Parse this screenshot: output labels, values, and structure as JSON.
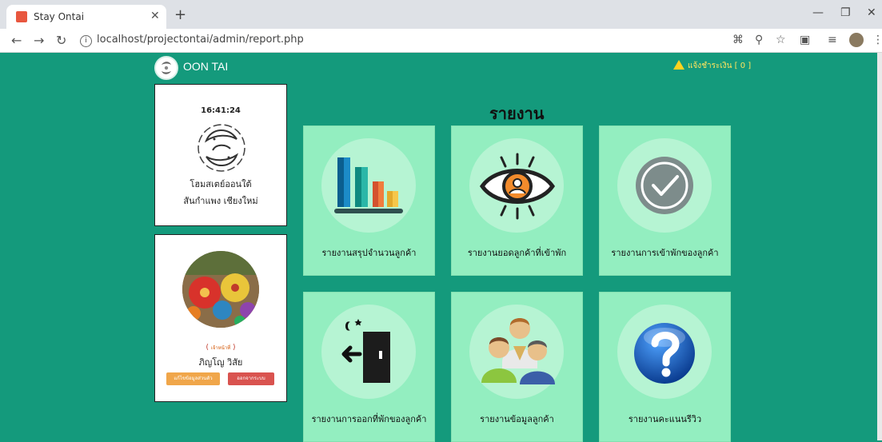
{
  "browser": {
    "tab_title": "Stay Ontai",
    "tab_favicon": "ON",
    "new_tab": "+",
    "url": "localhost/projectontai/admin/report.php",
    "info_glyph": "i"
  },
  "header": {
    "brand": "OON TAI",
    "alert_text": "แจ้งชำระเงิน [ 0 ]"
  },
  "sidebar": {
    "clock": "16:41:24",
    "hotel_name": "โฮมสเตย์ออนใต้",
    "hotel_address": "สันกำแพง เชียงใหม่",
    "role_open": "(",
    "role": "เจ้าหน้าที่",
    "role_close": ")",
    "user_name": "ภิญโญ วิสัย",
    "edit_button": "แก้ไขข้อมูลส่วนตัว",
    "logout_button": "ออกจากระบบ"
  },
  "main": {
    "title": "รายงาน",
    "tiles": [
      {
        "label": "รายงานสรุปจำนวนลูกค้า",
        "icon": "bar-chart-icon"
      },
      {
        "label": "รายงานยอดลูกค้าที่เข้าพัก",
        "icon": "eye-icon"
      },
      {
        "label": "รายงานการเข้าพักของลูกค้า",
        "icon": "check-circle-icon"
      },
      {
        "label": "รายงานการออกที่พักของลูกค้า",
        "icon": "exit-door-icon"
      },
      {
        "label": "รายงานข้อมูลลูกค้า",
        "icon": "users-icon"
      },
      {
        "label": "รายงานคะแนนรีวิว",
        "icon": "question-icon"
      }
    ]
  },
  "colors": {
    "page_bg": "#149a7c",
    "tile_bg": "#93eec0",
    "alert": "#ffd21f"
  }
}
